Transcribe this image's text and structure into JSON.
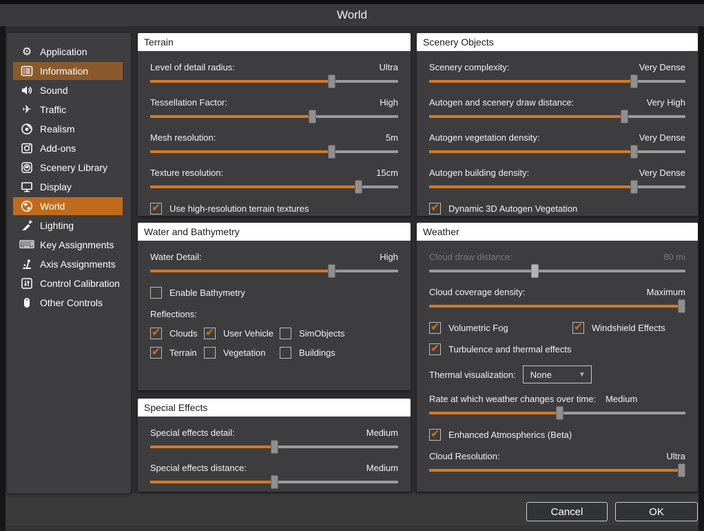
{
  "title": "World",
  "colors": {
    "accent_orange": "#d9791d",
    "selected_item": "#c06b1c",
    "hover_item": "#8a5a2b",
    "check_orange": "#c2691f"
  },
  "sidebar": {
    "items": [
      {
        "label": "Application",
        "icon": "application"
      },
      {
        "label": "Information",
        "icon": "information",
        "state": "hover"
      },
      {
        "label": "Sound",
        "icon": "sound"
      },
      {
        "label": "Traffic",
        "icon": "traffic"
      },
      {
        "label": "Realism",
        "icon": "realism"
      },
      {
        "label": "Add-ons",
        "icon": "addons"
      },
      {
        "label": "Scenery Library",
        "icon": "scenery-library"
      },
      {
        "label": "Display",
        "icon": "display"
      },
      {
        "label": "World",
        "icon": "world",
        "state": "selected"
      },
      {
        "label": "Lighting",
        "icon": "lighting"
      },
      {
        "label": "Key Assignments",
        "icon": "key-assignments"
      },
      {
        "label": "Axis Assignments",
        "icon": "axis-assignments"
      },
      {
        "label": "Control Calibration",
        "icon": "control-calibration"
      },
      {
        "label": "Other Controls",
        "icon": "other-controls"
      }
    ]
  },
  "panels": [
    {
      "title": "Terrain",
      "rows": [
        {
          "type": "slider",
          "label": "Level of detail radius:",
          "value": "Ultra",
          "pct": 74
        },
        {
          "type": "slider",
          "label": "Tessellation Factor:",
          "value": "High",
          "pct": 66
        },
        {
          "type": "slider",
          "label": "Mesh resolution:",
          "value": "5m",
          "pct": 74
        },
        {
          "type": "slider",
          "label": "Texture resolution:",
          "value": "15cm",
          "pct": 85
        },
        {
          "type": "checkbox",
          "label": "Use high-resolution terrain textures",
          "checked": true
        }
      ]
    },
    {
      "title": "Water and Bathymetry",
      "rows": [
        {
          "type": "slider",
          "label": "Water Detail:",
          "value": "High",
          "pct": 74
        },
        {
          "type": "checkbox",
          "label": "Enable Bathymetry",
          "checked": false
        },
        {
          "type": "text",
          "text": "Reflections:"
        },
        {
          "type": "checkgrid",
          "columns": "78px 110px auto",
          "items": [
            {
              "label": "Clouds",
              "checked": true
            },
            {
              "label": "User Vehicle",
              "checked": true
            },
            {
              "label": "SimObjects",
              "checked": false
            },
            {
              "label": "Terrain",
              "checked": true
            },
            {
              "label": "Vegetation",
              "checked": false
            },
            {
              "label": "Buildings",
              "checked": false
            }
          ]
        }
      ]
    },
    {
      "title": "Special Effects",
      "rows": [
        {
          "type": "slider",
          "label": "Special effects detail:",
          "value": "Medium",
          "pct": 50
        },
        {
          "type": "slider",
          "label": "Special effects distance:",
          "value": "Medium",
          "pct": 50
        }
      ]
    },
    {
      "title": "Scenery Objects",
      "rows": [
        {
          "type": "slider",
          "label": "Scenery complexity:",
          "value": "Very Dense",
          "pct": 81
        },
        {
          "type": "slider",
          "label": "Autogen and scenery draw distance:",
          "value": "Very High",
          "pct": 77
        },
        {
          "type": "slider",
          "label": "Autogen vegetation density:",
          "value": "Very Dense",
          "pct": 81
        },
        {
          "type": "slider",
          "label": "Autogen building density:",
          "value": "Very Dense",
          "pct": 81
        },
        {
          "type": "checkbox",
          "label": "Dynamic 3D Autogen Vegetation",
          "checked": true
        }
      ]
    },
    {
      "title": "Weather",
      "rows": [
        {
          "type": "slider",
          "label": "Cloud draw distance:",
          "value": "80 mi",
          "pct": 41,
          "disabled": true
        },
        {
          "type": "slider",
          "label": "Cloud coverage density:",
          "value": "Maximum",
          "pct": 100
        },
        {
          "type": "checkgrid",
          "columns": "208px auto",
          "items": [
            {
              "label": "Volumetric Fog",
              "checked": true
            },
            {
              "label": "Windshield Effects",
              "checked": true
            }
          ]
        },
        {
          "type": "checkbox",
          "label": "Turbulence and thermal effects",
          "checked": true
        },
        {
          "type": "dropdown",
          "label": "Thermal visualization:",
          "value": "None"
        },
        {
          "type": "slider",
          "label": "Rate at which weather changes over time:",
          "value": "Medium",
          "pct": 51,
          "inline": true
        },
        {
          "type": "checkbox",
          "label": "Enhanced Atmospherics (Beta)",
          "checked": true
        },
        {
          "type": "slider",
          "label": "Cloud Resolution:",
          "value": "Ultra",
          "pct": 100
        }
      ]
    },
    {
      "footer_note": ""
    }
  ],
  "footer": {
    "cancel_label": "Cancel",
    "ok_label": "OK"
  }
}
